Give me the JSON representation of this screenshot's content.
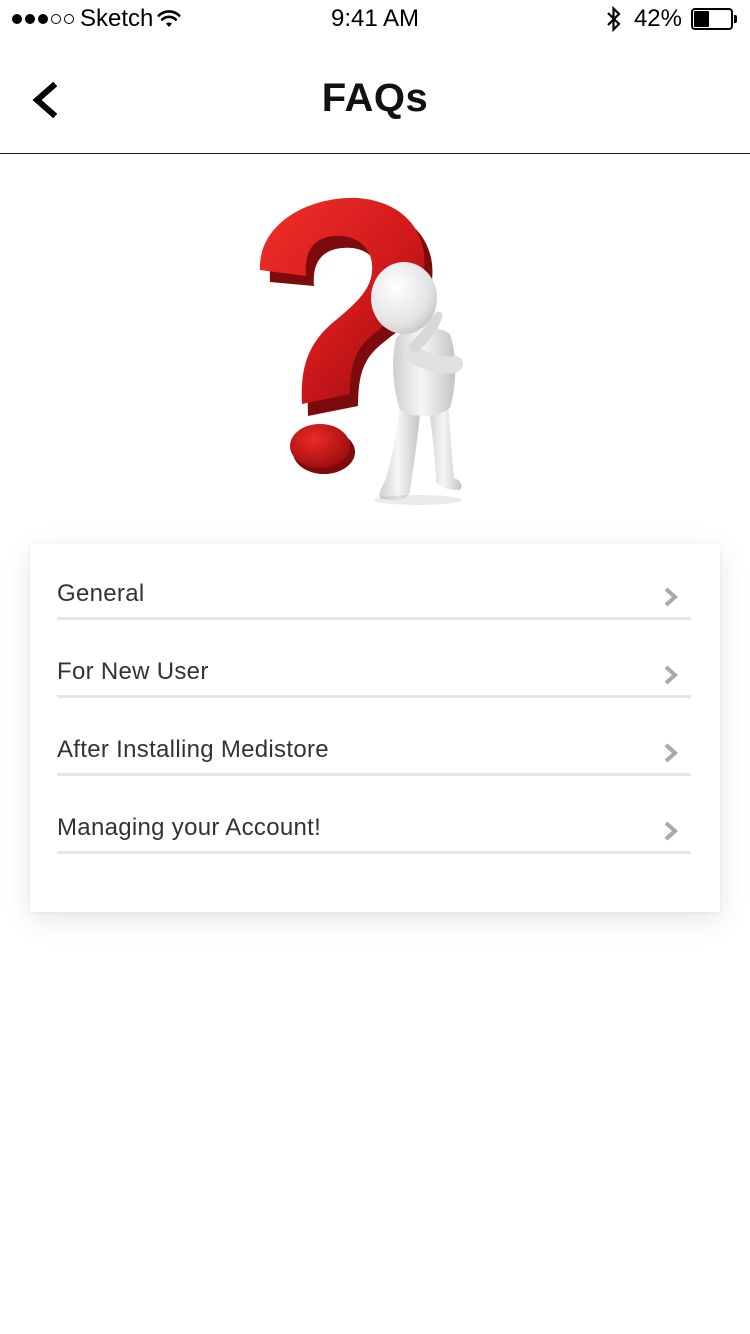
{
  "status_bar": {
    "signal_dots_total": 5,
    "signal_dots_filled": 3,
    "carrier": "Sketch",
    "wifi_icon": "wifi-icon",
    "time": "9:41 AM",
    "bluetooth_icon": "bluetooth-icon",
    "battery_percent_text": "42%",
    "battery_level": 0.42
  },
  "header": {
    "back_icon": "chevron-left-icon",
    "title": "FAQs"
  },
  "hero": {
    "illustration": "question-mark-figure-illustration",
    "accent_color": "#d0191b"
  },
  "faq": {
    "chevron_icon": "chevron-right-icon",
    "chevron_color": "#a8a8a8",
    "items": [
      {
        "label": "General"
      },
      {
        "label": "For New User"
      },
      {
        "label": "After Installing Medistore"
      },
      {
        "label": "Managing your Account!"
      }
    ]
  }
}
